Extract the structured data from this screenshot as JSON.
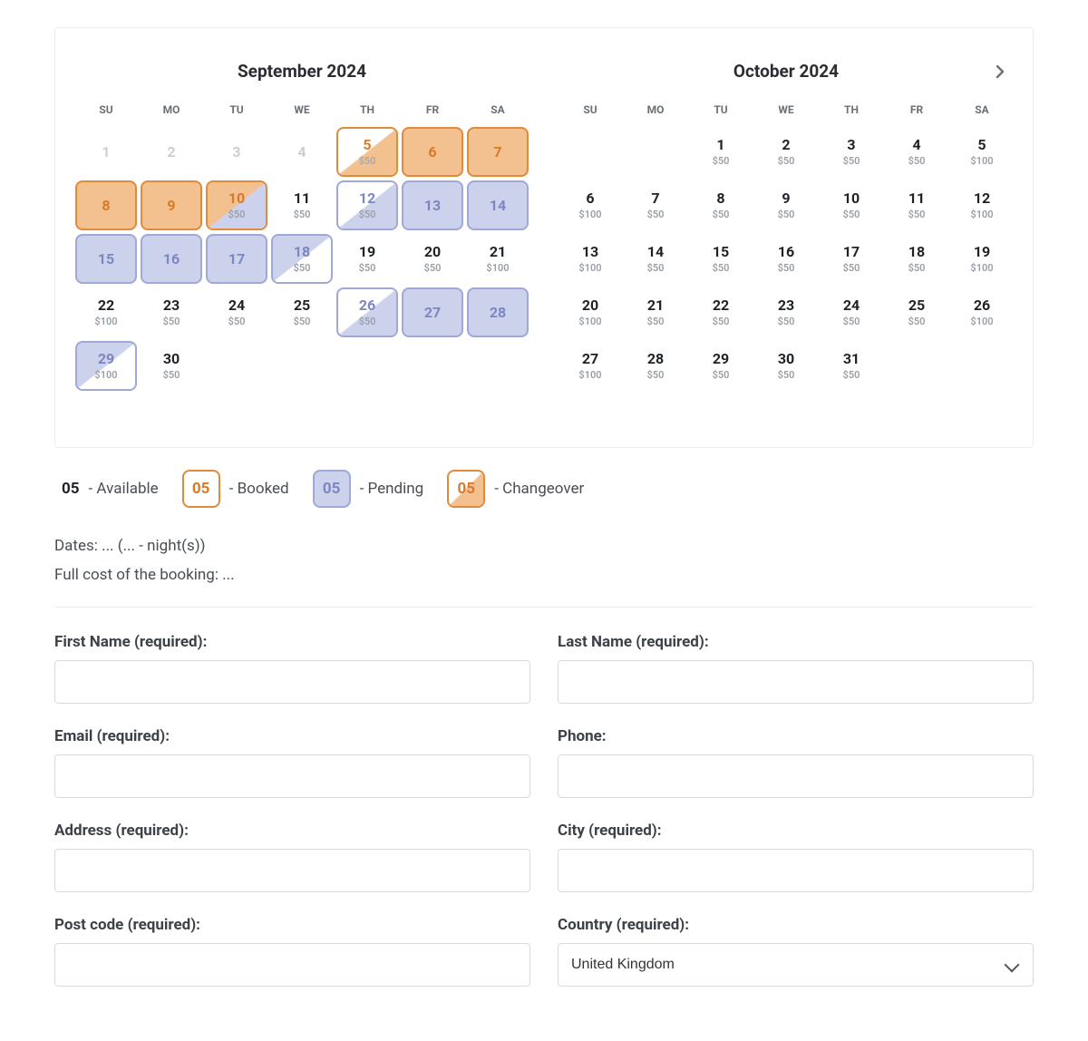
{
  "dow": [
    "SU",
    "MO",
    "TU",
    "WE",
    "TH",
    "FR",
    "SA"
  ],
  "months": [
    {
      "title": "September 2024",
      "weeks": [
        [
          {
            "n": "1",
            "dim": true
          },
          {
            "n": "2",
            "dim": true
          },
          {
            "n": "3",
            "dim": true
          },
          {
            "n": "4",
            "dim": true
          },
          {
            "n": "5",
            "price": "$50",
            "status": "chg-ob"
          },
          {
            "n": "6",
            "status": "booked"
          },
          {
            "n": "7",
            "status": "booked"
          }
        ],
        [
          {
            "n": "8",
            "status": "booked"
          },
          {
            "n": "9",
            "status": "booked"
          },
          {
            "n": "10",
            "price": "$50",
            "status": "chg-bp"
          },
          {
            "n": "11",
            "price": "$50"
          },
          {
            "n": "12",
            "price": "$50",
            "status": "chg-po"
          },
          {
            "n": "13",
            "status": "pending"
          },
          {
            "n": "14",
            "status": "pending"
          }
        ],
        [
          {
            "n": "15",
            "status": "pending"
          },
          {
            "n": "16",
            "status": "pending"
          },
          {
            "n": "17",
            "status": "pending"
          },
          {
            "n": "18",
            "price": "$50",
            "status": "chg-op"
          },
          {
            "n": "19",
            "price": "$50"
          },
          {
            "n": "20",
            "price": "$50"
          },
          {
            "n": "21",
            "price": "$100"
          }
        ],
        [
          {
            "n": "22",
            "price": "$100"
          },
          {
            "n": "23",
            "price": "$50"
          },
          {
            "n": "24",
            "price": "$50"
          },
          {
            "n": "25",
            "price": "$50"
          },
          {
            "n": "26",
            "price": "$50",
            "status": "chg-po"
          },
          {
            "n": "27",
            "status": "pending"
          },
          {
            "n": "28",
            "status": "pending"
          }
        ],
        [
          {
            "n": "29",
            "price": "$100",
            "status": "chg-op"
          },
          {
            "n": "30",
            "price": "$50"
          },
          {
            "blank": true
          },
          {
            "blank": true
          },
          {
            "blank": true
          },
          {
            "blank": true
          },
          {
            "blank": true
          }
        ]
      ]
    },
    {
      "title": "October 2024",
      "weeks": [
        [
          {
            "blank": true
          },
          {
            "blank": true
          },
          {
            "n": "1",
            "price": "$50"
          },
          {
            "n": "2",
            "price": "$50"
          },
          {
            "n": "3",
            "price": "$50"
          },
          {
            "n": "4",
            "price": "$50"
          },
          {
            "n": "5",
            "price": "$100"
          }
        ],
        [
          {
            "n": "6",
            "price": "$100"
          },
          {
            "n": "7",
            "price": "$50"
          },
          {
            "n": "8",
            "price": "$50"
          },
          {
            "n": "9",
            "price": "$50"
          },
          {
            "n": "10",
            "price": "$50"
          },
          {
            "n": "11",
            "price": "$50"
          },
          {
            "n": "12",
            "price": "$100"
          }
        ],
        [
          {
            "n": "13",
            "price": "$100"
          },
          {
            "n": "14",
            "price": "$50"
          },
          {
            "n": "15",
            "price": "$50"
          },
          {
            "n": "16",
            "price": "$50"
          },
          {
            "n": "17",
            "price": "$50"
          },
          {
            "n": "18",
            "price": "$50"
          },
          {
            "n": "19",
            "price": "$100"
          }
        ],
        [
          {
            "n": "20",
            "price": "$100"
          },
          {
            "n": "21",
            "price": "$50"
          },
          {
            "n": "22",
            "price": "$50"
          },
          {
            "n": "23",
            "price": "$50"
          },
          {
            "n": "24",
            "price": "$50"
          },
          {
            "n": "25",
            "price": "$50"
          },
          {
            "n": "26",
            "price": "$100"
          }
        ],
        [
          {
            "n": "27",
            "price": "$100"
          },
          {
            "n": "28",
            "price": "$50"
          },
          {
            "n": "29",
            "price": "$50"
          },
          {
            "n": "30",
            "price": "$50"
          },
          {
            "n": "31",
            "price": "$50"
          },
          {
            "blank": true
          },
          {
            "blank": true
          }
        ]
      ]
    }
  ],
  "legend": {
    "sample": "05",
    "available": "- Available",
    "booked": "- Booked",
    "pending": "- Pending",
    "changeover": "- Changeover"
  },
  "summary": {
    "dates": "Dates: ... (... - night(s))",
    "cost": "Full cost of the booking: ..."
  },
  "form": {
    "first_name": "First Name (required):",
    "last_name": "Last Name (required):",
    "email": "Email (required):",
    "phone": "Phone:",
    "address": "Address (required):",
    "city": "City (required):",
    "postcode": "Post code (required):",
    "country": "Country (required):",
    "country_value": "United Kingdom"
  }
}
